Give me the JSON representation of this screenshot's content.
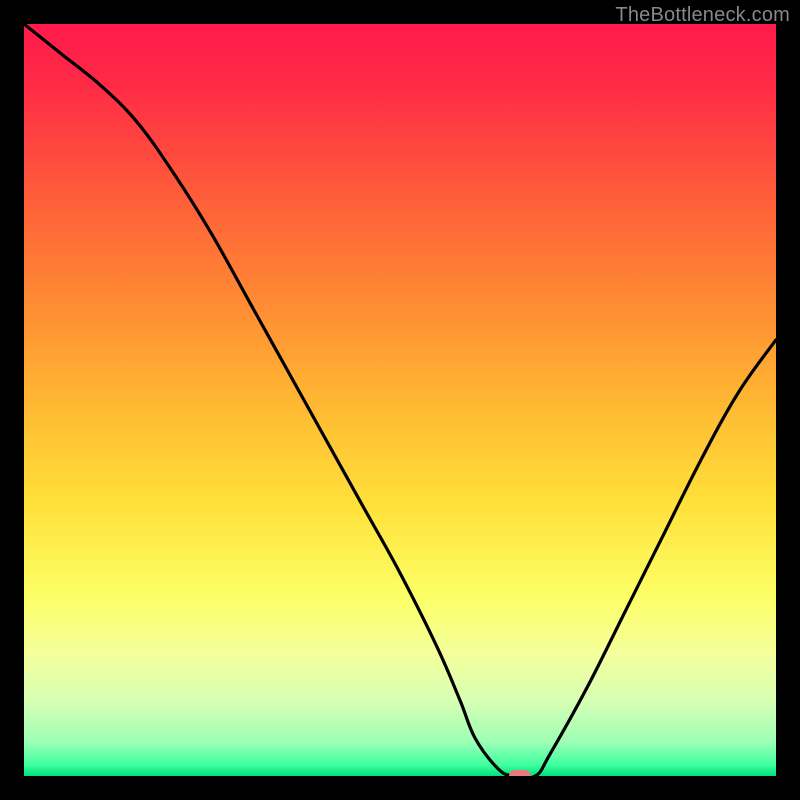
{
  "watermark": "TheBottleneck.com",
  "colors": {
    "top": "#ff1a4b",
    "mid_upper": "#ff9a2e",
    "mid": "#ffe13a",
    "mid_lower": "#f6ff8a",
    "lower": "#b6ffb0",
    "bottom": "#00e07a",
    "curve": "#000000",
    "marker": "#e87b7b",
    "frame": "#000000"
  },
  "chart_data": {
    "type": "line",
    "title": "",
    "xlabel": "",
    "ylabel": "",
    "xlim": [
      0,
      100
    ],
    "ylim": [
      0,
      100
    ],
    "x": [
      0,
      5,
      10,
      15,
      20,
      25,
      30,
      35,
      40,
      45,
      50,
      55,
      58,
      60,
      63,
      65,
      68,
      70,
      75,
      80,
      85,
      90,
      95,
      100
    ],
    "values": [
      100,
      96,
      92,
      87,
      80,
      72,
      63,
      54,
      45,
      36,
      27,
      17,
      10,
      5,
      1,
      0,
      0,
      3,
      12,
      22,
      32,
      42,
      51,
      58
    ],
    "marker": {
      "x": 66,
      "y": 0
    },
    "notes": "V-shaped bottleneck curve; minimum (0) around x≈65–68. y expressed as percentage of plot height from bottom."
  }
}
